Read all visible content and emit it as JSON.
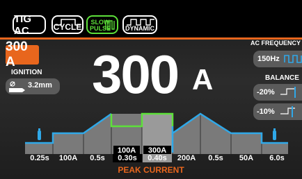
{
  "toolbar": {
    "tig_label": "TIG AC",
    "cycle_label": "CYCLE",
    "slow_pulse_line1": "SLOW",
    "slow_pulse_line2": "PULSE",
    "dynamic_label": "DYNAMIC"
  },
  "current": {
    "set_value": "300 A",
    "main_value": "300",
    "main_unit": "A"
  },
  "ignition": {
    "label": "IGNITION",
    "value": "3.2mm"
  },
  "ac_frequency": {
    "label": "AC FREQUENCY",
    "value": "150Hz"
  },
  "balance": {
    "label": "BALANCE",
    "values": [
      "-20%",
      "-10%"
    ]
  },
  "cycle_graph": {
    "segment_values": [
      "0.25s",
      "100A",
      "0.5s",
      "0.30s",
      "0.40s",
      "200A",
      "0.5s",
      "50A",
      "6.0s"
    ],
    "pulse_labels": [
      "100A",
      "300A"
    ],
    "caption": "PEAK CURRENT"
  },
  "colors": {
    "accent": "#e8661d",
    "curve": "#2fa8e8",
    "peak": "#5de03a",
    "panel": "#5b5b5b"
  }
}
